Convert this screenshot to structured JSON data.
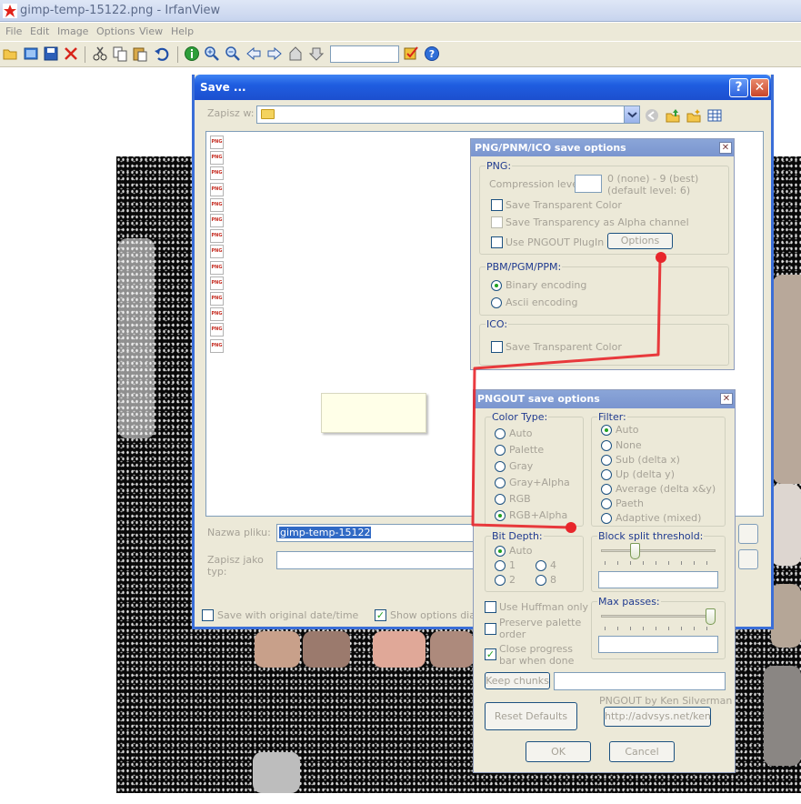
{
  "window": {
    "title": "gimp-temp-15122.png - IrfanView"
  },
  "menu": [
    "File",
    "Edit",
    "Image",
    "Options",
    "View",
    "Help"
  ],
  "toolbar": {
    "icons": [
      "open-icon",
      "slideshow-icon",
      "save-icon",
      "delete-icon",
      "cut-icon",
      "copy-icon",
      "paste-icon",
      "undo-icon",
      "info-icon",
      "zoom-in-icon",
      "zoom-out-icon",
      "previous-icon",
      "next-icon",
      "thumbnails-icon",
      "scan-icon",
      "settings-icon",
      "help-icon"
    ],
    "zoom_value": ""
  },
  "save_dialog": {
    "title": "Save ...",
    "help_glyph": "?",
    "close_glyph": "✕",
    "lookin_label": "Zapisz w:",
    "lookin_value": "",
    "file_icons": [
      "PNG",
      "PNG",
      "PNG",
      "PNG",
      "PNG",
      "PNG",
      "PNG",
      "PNG",
      "PNG",
      "PNG",
      "PNG",
      "PNG",
      "PNG",
      "PNG"
    ],
    "filename_label": "Nazwa pliku:",
    "filename_value": "gimp-temp-15122",
    "type_label_line1": "Zapisz jako",
    "type_label_line2": "typ:",
    "type_value": "",
    "original_date_label": "Save with original date/time",
    "original_date_checked": false,
    "show_options_label": "Show options dialog",
    "show_options_checked": true
  },
  "png_options": {
    "title": "PNG/PNM/ICO save options",
    "close_glyph": "✕",
    "png_group": "PNG:",
    "compression_label": "Compression level:",
    "compression_value": "",
    "compression_hint_1": "0 (none) - 9 (best)",
    "compression_hint_2": "(default level: 6)",
    "save_transparent": "Save Transparent Color",
    "save_alpha": "Save Transparency as Alpha channel",
    "use_pngout": "Use PNGOUT PlugIn",
    "options_button": "Options",
    "pbm_group": "PBM/PGM/PPM:",
    "binary_encoding": "Binary encoding",
    "binary_selected": true,
    "ascii_encoding": "Ascii encoding",
    "ico_group": "ICO:",
    "ico_transparent": "Save Transparent Color"
  },
  "pngout_options": {
    "title": "PNGOUT save options",
    "close_glyph": "✕",
    "color_type_group": "Color Type:",
    "color_types": [
      "Auto",
      "Palette",
      "Gray",
      "Gray+Alpha",
      "RGB",
      "RGB+Alpha"
    ],
    "color_type_selected": "RGB+Alpha",
    "filter_group": "Filter:",
    "filters": [
      "Auto",
      "None",
      "Sub (delta x)",
      "Up (delta y)",
      "Average (delta x&y)",
      "Paeth",
      "Adaptive (mixed)"
    ],
    "filter_selected": "Auto",
    "bit_depth_group": "Bit Depth:",
    "bit_depths": [
      "Auto",
      "1",
      "4",
      "2",
      "8"
    ],
    "bit_depth_selected": "Auto",
    "block_split_group": "Block split threshold:",
    "block_split_value": "",
    "block_split_level": 0.28,
    "use_huffman": "Use Huffman only",
    "use_huffman_checked": false,
    "preserve_palette_1": "Preserve palette",
    "preserve_palette_2": "order",
    "preserve_palette_checked": false,
    "close_progress_1": "Close progress",
    "close_progress_2": "bar when done",
    "close_progress_checked": true,
    "max_passes_group": "Max passes:",
    "max_passes_value": "",
    "max_passes_level": 1.0,
    "keep_chunks_button": "Keep chunks",
    "keep_chunks_value": "",
    "credit": "PNGOUT by Ken Silverman",
    "reset_button": "Reset Defaults",
    "link_button": "http://advsys.net/ken",
    "ok_button": "OK",
    "cancel_button": "Cancel"
  },
  "colors": {
    "xp_title_blue": "#1f5de0",
    "dialog_face": "#ece9d8",
    "annotation_red": "#e8262b",
    "check_green": "#21a121"
  }
}
